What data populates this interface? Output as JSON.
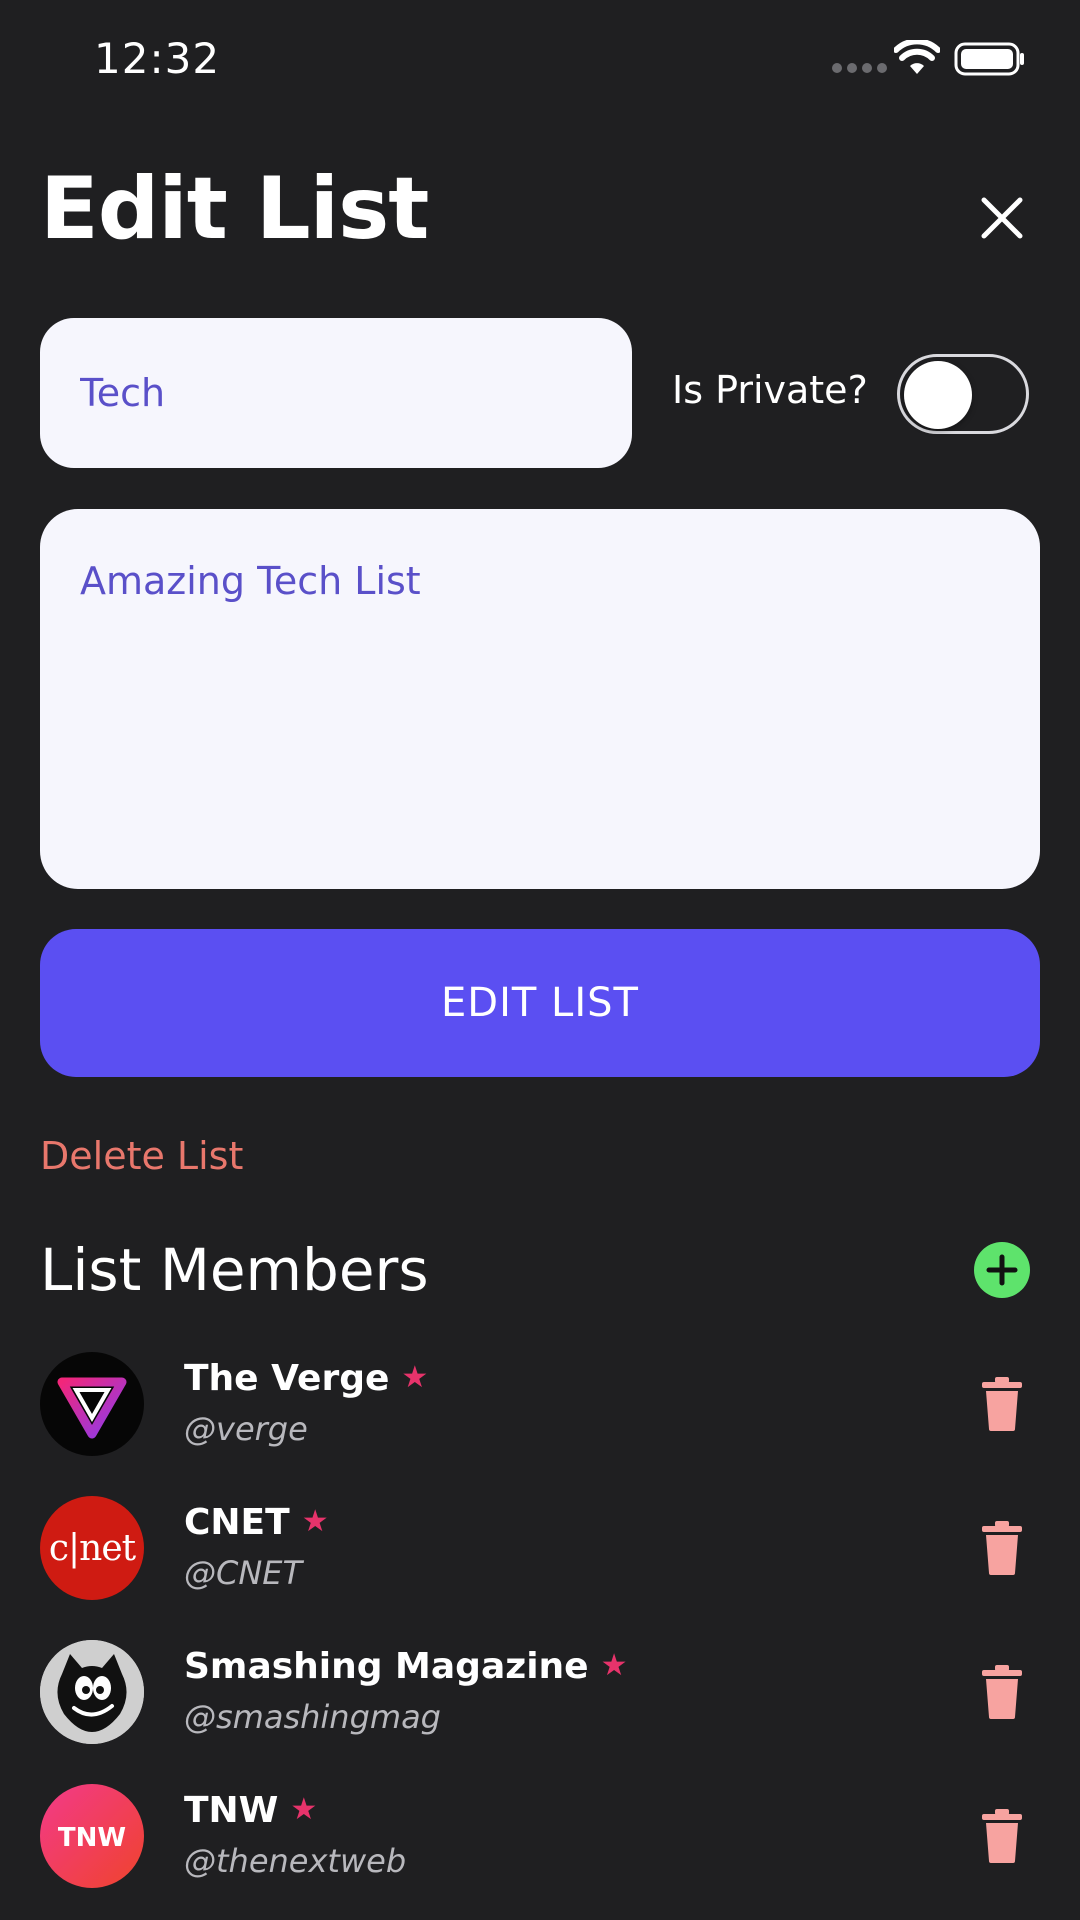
{
  "status_bar": {
    "time": "12:32"
  },
  "header": {
    "title": "Edit List"
  },
  "form": {
    "name_value": "Tech",
    "private_label": "Is Private?",
    "private_enabled": false,
    "description_value": "Amazing Tech List",
    "submit_label": "EDIT LIST",
    "delete_label": "Delete List"
  },
  "members_section": {
    "title": "List Members",
    "members": [
      {
        "name": "The Verge",
        "handle": "@verge",
        "starred": true,
        "avatar_icon": "verge-logo"
      },
      {
        "name": "CNET",
        "handle": "@CNET",
        "starred": true,
        "avatar_icon": "cnet-logo"
      },
      {
        "name": "Smashing Magazine",
        "handle": "@smashingmag",
        "starred": true,
        "avatar_icon": "smashing-cat-logo"
      },
      {
        "name": "TNW",
        "handle": "@thenextweb",
        "starred": true,
        "avatar_icon": "tnw-logo"
      }
    ]
  },
  "icons": {
    "close": "close-icon",
    "add": "plus-circle-icon",
    "delete": "trash-icon",
    "star": "star-icon"
  },
  "colors": {
    "background": "#1f1f21",
    "accent": "#5b4ff2",
    "input_text": "#5a50c9",
    "danger": "#e8776c",
    "add": "#5ee36c",
    "star": "#e7336b",
    "trash": "#f7a3a0"
  }
}
